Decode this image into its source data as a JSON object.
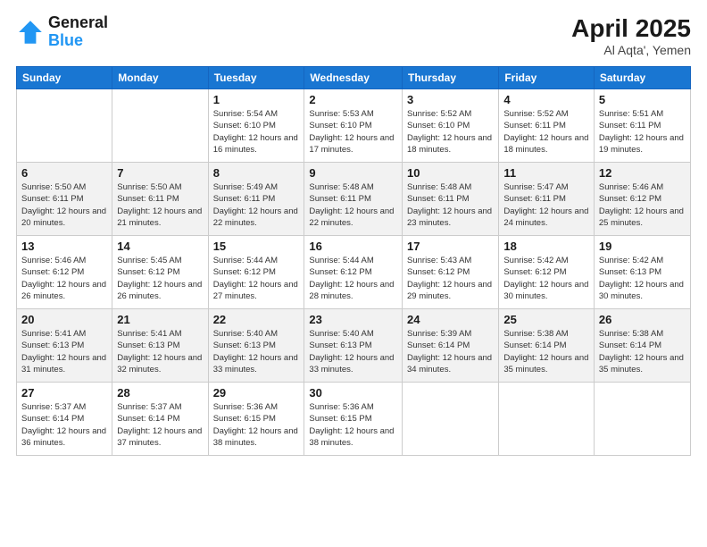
{
  "header": {
    "logo_line1": "General",
    "logo_line2": "Blue",
    "month": "April 2025",
    "location": "Al Aqta', Yemen"
  },
  "weekdays": [
    "Sunday",
    "Monday",
    "Tuesday",
    "Wednesday",
    "Thursday",
    "Friday",
    "Saturday"
  ],
  "weeks": [
    [
      {
        "day": "",
        "info": ""
      },
      {
        "day": "",
        "info": ""
      },
      {
        "day": "1",
        "info": "Sunrise: 5:54 AM\nSunset: 6:10 PM\nDaylight: 12 hours and 16 minutes."
      },
      {
        "day": "2",
        "info": "Sunrise: 5:53 AM\nSunset: 6:10 PM\nDaylight: 12 hours and 17 minutes."
      },
      {
        "day": "3",
        "info": "Sunrise: 5:52 AM\nSunset: 6:10 PM\nDaylight: 12 hours and 18 minutes."
      },
      {
        "day": "4",
        "info": "Sunrise: 5:52 AM\nSunset: 6:11 PM\nDaylight: 12 hours and 18 minutes."
      },
      {
        "day": "5",
        "info": "Sunrise: 5:51 AM\nSunset: 6:11 PM\nDaylight: 12 hours and 19 minutes."
      }
    ],
    [
      {
        "day": "6",
        "info": "Sunrise: 5:50 AM\nSunset: 6:11 PM\nDaylight: 12 hours and 20 minutes."
      },
      {
        "day": "7",
        "info": "Sunrise: 5:50 AM\nSunset: 6:11 PM\nDaylight: 12 hours and 21 minutes."
      },
      {
        "day": "8",
        "info": "Sunrise: 5:49 AM\nSunset: 6:11 PM\nDaylight: 12 hours and 22 minutes."
      },
      {
        "day": "9",
        "info": "Sunrise: 5:48 AM\nSunset: 6:11 PM\nDaylight: 12 hours and 22 minutes."
      },
      {
        "day": "10",
        "info": "Sunrise: 5:48 AM\nSunset: 6:11 PM\nDaylight: 12 hours and 23 minutes."
      },
      {
        "day": "11",
        "info": "Sunrise: 5:47 AM\nSunset: 6:11 PM\nDaylight: 12 hours and 24 minutes."
      },
      {
        "day": "12",
        "info": "Sunrise: 5:46 AM\nSunset: 6:12 PM\nDaylight: 12 hours and 25 minutes."
      }
    ],
    [
      {
        "day": "13",
        "info": "Sunrise: 5:46 AM\nSunset: 6:12 PM\nDaylight: 12 hours and 26 minutes."
      },
      {
        "day": "14",
        "info": "Sunrise: 5:45 AM\nSunset: 6:12 PM\nDaylight: 12 hours and 26 minutes."
      },
      {
        "day": "15",
        "info": "Sunrise: 5:44 AM\nSunset: 6:12 PM\nDaylight: 12 hours and 27 minutes."
      },
      {
        "day": "16",
        "info": "Sunrise: 5:44 AM\nSunset: 6:12 PM\nDaylight: 12 hours and 28 minutes."
      },
      {
        "day": "17",
        "info": "Sunrise: 5:43 AM\nSunset: 6:12 PM\nDaylight: 12 hours and 29 minutes."
      },
      {
        "day": "18",
        "info": "Sunrise: 5:42 AM\nSunset: 6:12 PM\nDaylight: 12 hours and 30 minutes."
      },
      {
        "day": "19",
        "info": "Sunrise: 5:42 AM\nSunset: 6:13 PM\nDaylight: 12 hours and 30 minutes."
      }
    ],
    [
      {
        "day": "20",
        "info": "Sunrise: 5:41 AM\nSunset: 6:13 PM\nDaylight: 12 hours and 31 minutes."
      },
      {
        "day": "21",
        "info": "Sunrise: 5:41 AM\nSunset: 6:13 PM\nDaylight: 12 hours and 32 minutes."
      },
      {
        "day": "22",
        "info": "Sunrise: 5:40 AM\nSunset: 6:13 PM\nDaylight: 12 hours and 33 minutes."
      },
      {
        "day": "23",
        "info": "Sunrise: 5:40 AM\nSunset: 6:13 PM\nDaylight: 12 hours and 33 minutes."
      },
      {
        "day": "24",
        "info": "Sunrise: 5:39 AM\nSunset: 6:14 PM\nDaylight: 12 hours and 34 minutes."
      },
      {
        "day": "25",
        "info": "Sunrise: 5:38 AM\nSunset: 6:14 PM\nDaylight: 12 hours and 35 minutes."
      },
      {
        "day": "26",
        "info": "Sunrise: 5:38 AM\nSunset: 6:14 PM\nDaylight: 12 hours and 35 minutes."
      }
    ],
    [
      {
        "day": "27",
        "info": "Sunrise: 5:37 AM\nSunset: 6:14 PM\nDaylight: 12 hours and 36 minutes."
      },
      {
        "day": "28",
        "info": "Sunrise: 5:37 AM\nSunset: 6:14 PM\nDaylight: 12 hours and 37 minutes."
      },
      {
        "day": "29",
        "info": "Sunrise: 5:36 AM\nSunset: 6:15 PM\nDaylight: 12 hours and 38 minutes."
      },
      {
        "day": "30",
        "info": "Sunrise: 5:36 AM\nSunset: 6:15 PM\nDaylight: 12 hours and 38 minutes."
      },
      {
        "day": "",
        "info": ""
      },
      {
        "day": "",
        "info": ""
      },
      {
        "day": "",
        "info": ""
      }
    ]
  ]
}
